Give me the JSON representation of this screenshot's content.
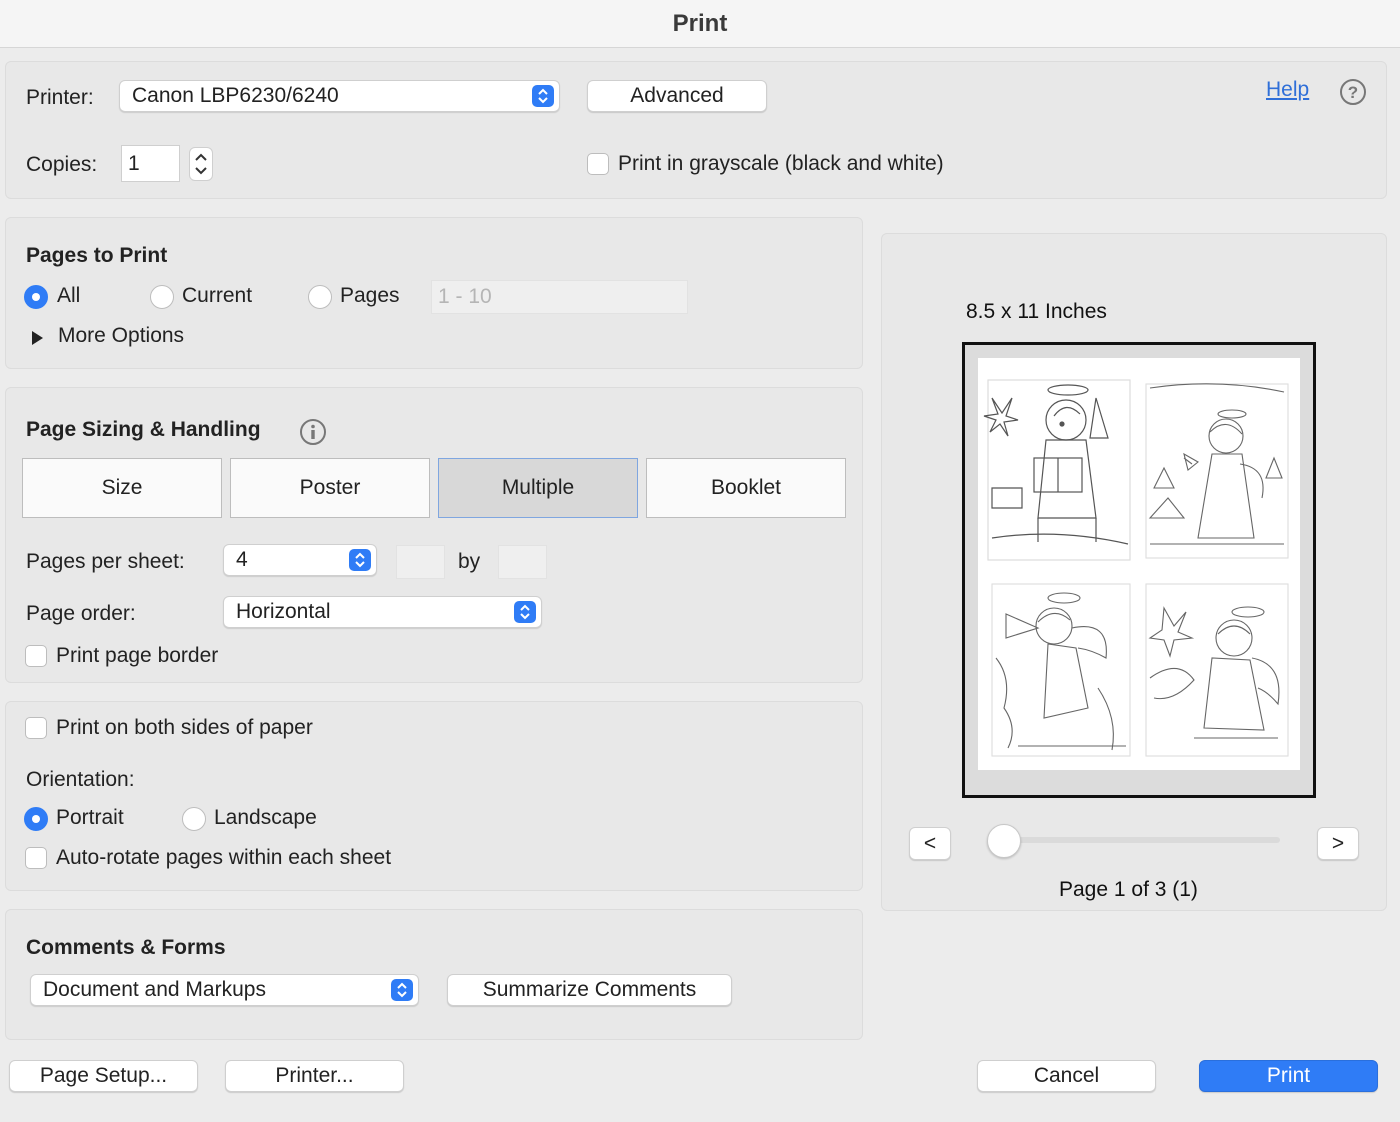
{
  "window": {
    "title": "Print"
  },
  "printer": {
    "label": "Printer:",
    "selected": "Canon LBP6230/6240",
    "advanced_label": "Advanced",
    "help_label": "Help",
    "copies_label": "Copies:",
    "copies_value": "1",
    "grayscale_label": "Print in grayscale (black and white)"
  },
  "pages_to_print": {
    "title": "Pages to Print",
    "options": [
      "All",
      "Current",
      "Pages"
    ],
    "selected": "All",
    "range_placeholder": "1 - 10",
    "more_options_label": "More Options"
  },
  "sizing": {
    "title": "Page Sizing & Handling",
    "tabs": [
      "Size",
      "Poster",
      "Multiple",
      "Booklet"
    ],
    "active_tab": "Multiple",
    "pages_per_sheet_label": "Pages per sheet:",
    "pages_per_sheet_value": "4",
    "by_label": "by",
    "page_order_label": "Page order:",
    "page_order_value": "Horizontal",
    "print_border_label": "Print page border"
  },
  "layout": {
    "both_sides_label": "Print on both sides of paper",
    "orientation_label": "Orientation:",
    "portrait_label": "Portrait",
    "landscape_label": "Landscape",
    "orientation_selected": "Portrait",
    "auto_rotate_label": "Auto-rotate pages within each sheet"
  },
  "comments": {
    "title": "Comments & Forms",
    "selected": "Document and Markups",
    "summarize_label": "Summarize Comments"
  },
  "preview": {
    "paper_size": "8.5 x 11 Inches",
    "prev_label": "<",
    "next_label": ">",
    "page_status": "Page 1 of 3 (1)"
  },
  "footer": {
    "page_setup_label": "Page Setup...",
    "printer_label": "Printer...",
    "cancel_label": "Cancel",
    "print_label": "Print"
  },
  "colors": {
    "accent": "#2f7cf6",
    "link": "#2f6fd8"
  }
}
